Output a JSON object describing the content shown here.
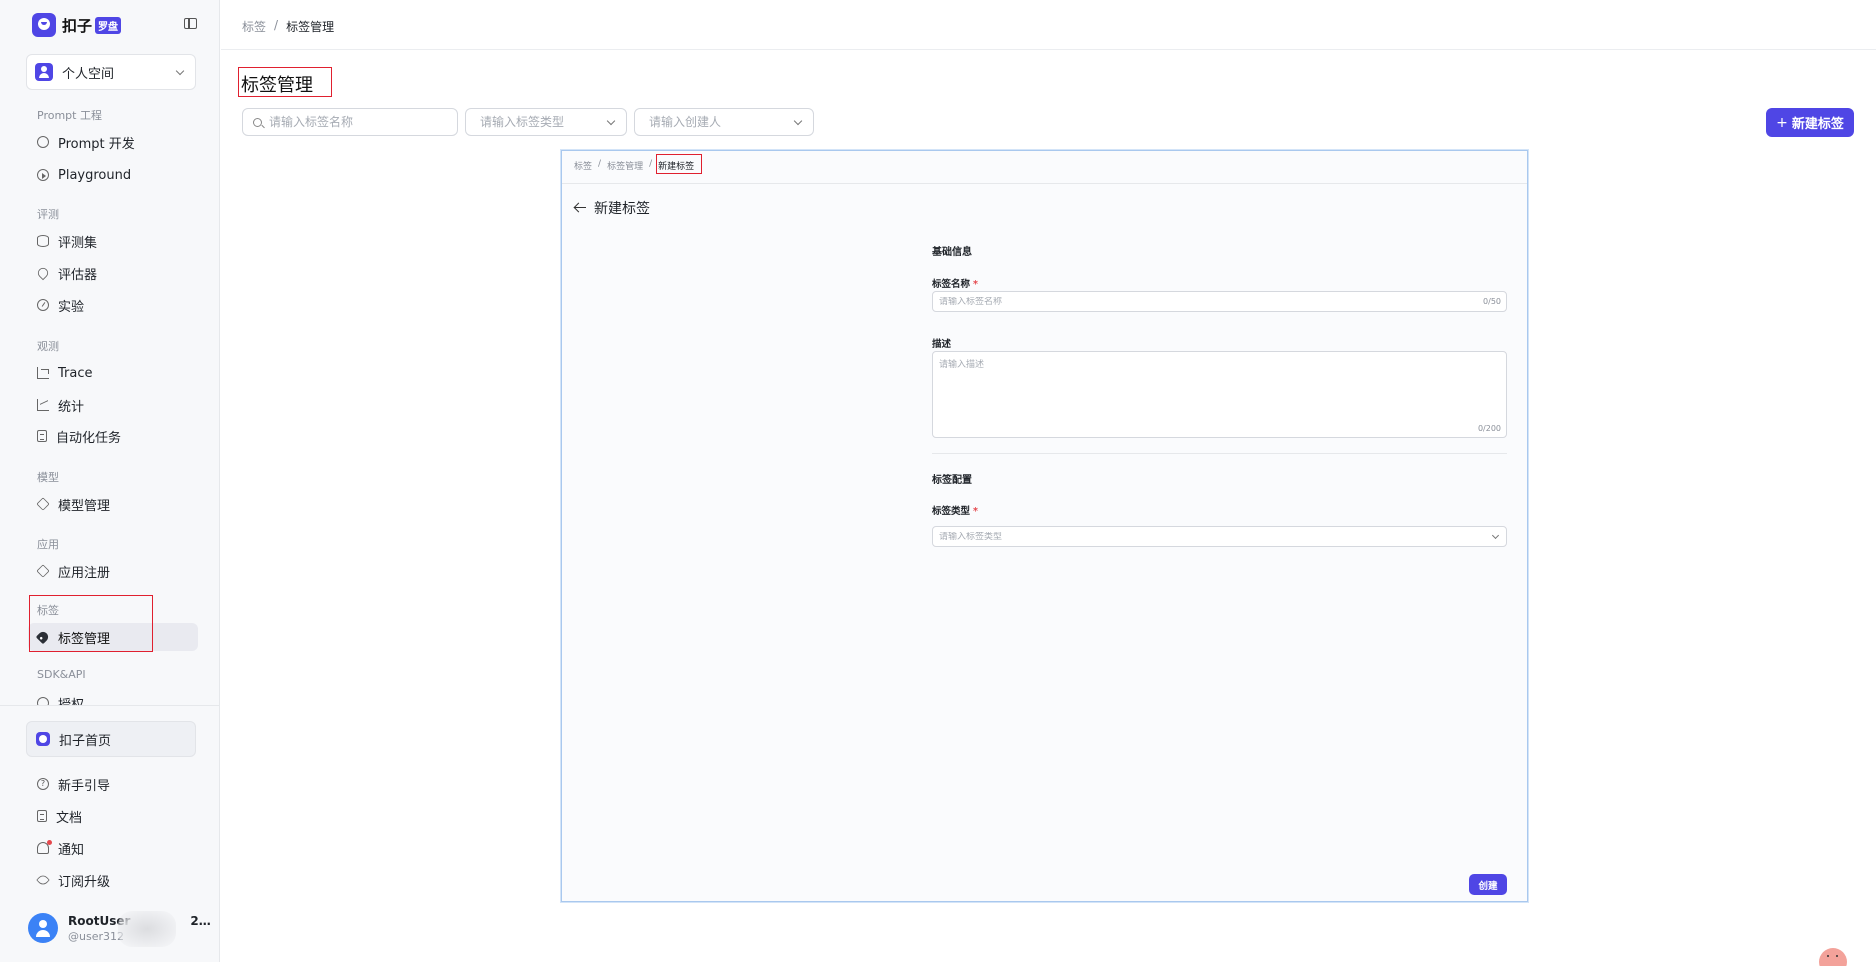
{
  "brand": {
    "name": "扣子",
    "tag": "罗盘"
  },
  "space": {
    "label": "个人空间"
  },
  "sidebar": {
    "groups": [
      {
        "label": "Prompt 工程",
        "items": [
          {
            "label": "Prompt 开发",
            "icon": "prompt-icon"
          },
          {
            "label": "Playground",
            "icon": "play-icon"
          }
        ]
      },
      {
        "label": "评测",
        "items": [
          {
            "label": "评测集",
            "icon": "database-icon"
          },
          {
            "label": "评估器",
            "icon": "evaluator-icon"
          },
          {
            "label": "实验",
            "icon": "gauge-icon"
          }
        ]
      },
      {
        "label": "观测",
        "items": [
          {
            "label": "Trace",
            "icon": "trace-icon"
          },
          {
            "label": "统计",
            "icon": "chart-icon"
          },
          {
            "label": "自动化任务",
            "icon": "task-icon"
          }
        ]
      },
      {
        "label": "模型",
        "items": [
          {
            "label": "模型管理",
            "icon": "model-icon"
          }
        ]
      },
      {
        "label": "应用",
        "items": [
          {
            "label": "应用注册",
            "icon": "app-icon"
          }
        ]
      },
      {
        "label": "标签",
        "items": [
          {
            "label": "标签管理",
            "icon": "tag-icon",
            "active": true
          }
        ]
      },
      {
        "label": "SDK&API",
        "items": [
          {
            "label": "授权",
            "icon": "key-icon"
          }
        ]
      }
    ],
    "home": {
      "label": "扣子首页"
    },
    "footer_items": [
      {
        "label": "新手引导",
        "icon": "help-icon"
      },
      {
        "label": "文档",
        "icon": "doc-icon"
      },
      {
        "label": "通知",
        "icon": "bell-icon"
      },
      {
        "label": "订阅升级",
        "icon": "rocket-icon"
      }
    ],
    "user": {
      "name": "RootUser",
      "name_suffix": "2…",
      "handle": "@user312"
    }
  },
  "header": {
    "breadcrumb": [
      "标签",
      "标签管理"
    ],
    "title": "标签管理"
  },
  "filters": {
    "search_placeholder": "请输入标签名称",
    "type_placeholder": "请输入标签类型",
    "creator_placeholder": "请输入创建人"
  },
  "actions": {
    "new_tag": "新建标签"
  },
  "panel": {
    "breadcrumb": [
      "标签",
      "标签管理",
      "新建标签"
    ],
    "title": "新建标签",
    "basic_section": "基础信息",
    "name_label": "标签名称",
    "name_placeholder": "请输入标签名称",
    "name_counter": "0/50",
    "desc_label": "描述",
    "desc_placeholder": "请输入描述",
    "desc_counter": "0/200",
    "config_section": "标签配置",
    "type_label": "标签类型",
    "type_placeholder": "请输入标签类型",
    "required_mark": "*",
    "create_button": "创建"
  },
  "colors": {
    "accent": "#4f46e5",
    "highlight": "#e0202f",
    "required": "#e5484d"
  }
}
